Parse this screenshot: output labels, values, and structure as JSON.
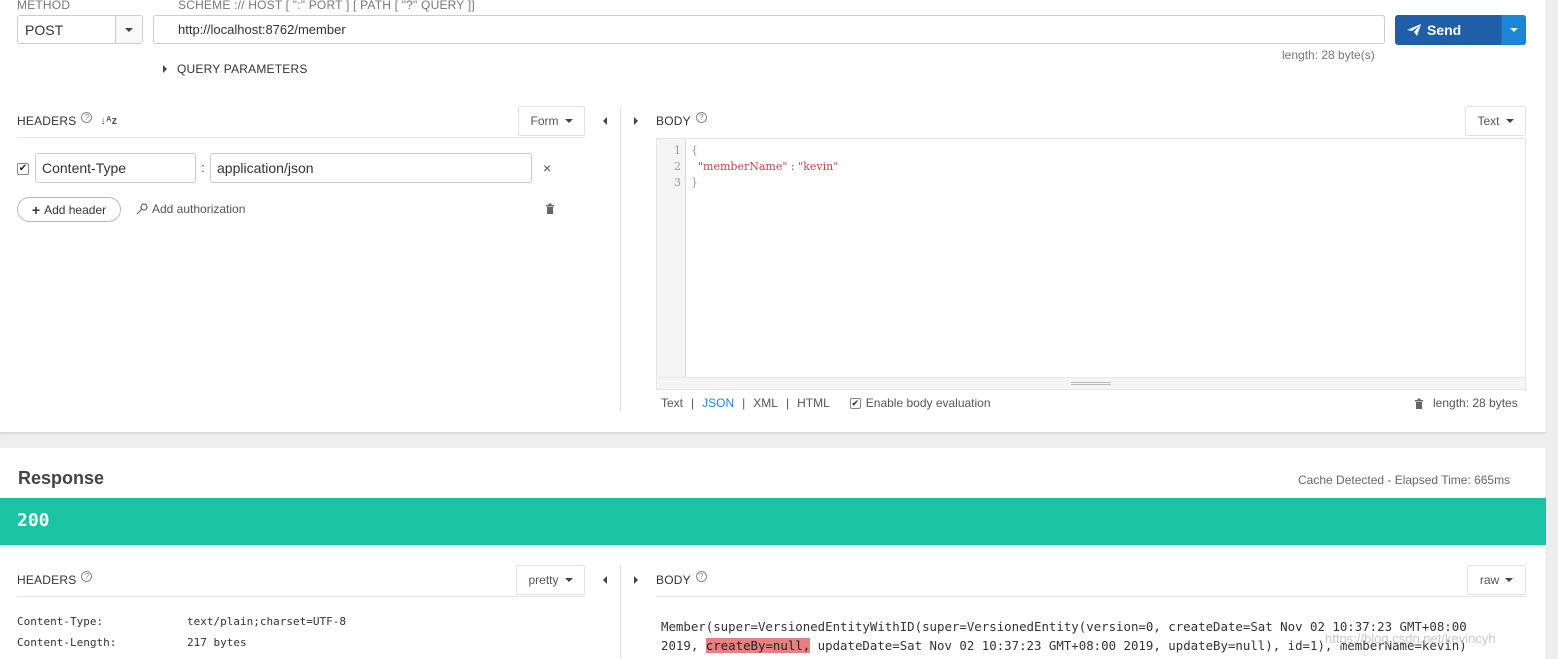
{
  "request": {
    "method_label": "METHOD",
    "method_value": "POST",
    "scheme_label": "SCHEME :// HOST [ \":\" PORT ] [ PATH [ \"?\" QUERY ]]",
    "url": "http://localhost:8762/member",
    "send_label": "Send",
    "length_note": "length: 28 byte(s)",
    "query_params_label": "QUERY PARAMETERS"
  },
  "req_headers": {
    "title": "HEADERS",
    "form_label": "Form",
    "items": [
      {
        "name": "Content-Type",
        "colon": ":",
        "value": "application/json",
        "remove": "×"
      }
    ],
    "add_header": "Add header",
    "add_authorization": "Add authorization"
  },
  "req_body": {
    "title": "BODY",
    "format_label": "Text",
    "line_numbers": [
      "1",
      "2",
      "3"
    ],
    "code": {
      "open": "{",
      "key": "\"memberName\"",
      "sep": " : ",
      "val": "\"kevin\"",
      "close": "}"
    },
    "footer": {
      "text": "Text",
      "json": "JSON",
      "xml": "XML",
      "html": "HTML",
      "separator": "|",
      "enable_eval": "Enable body evaluation",
      "length": "length: 28 bytes"
    }
  },
  "response": {
    "title": "Response",
    "elapsed": "Cache Detected - Elapsed Time: 665ms",
    "status": "200",
    "status_color": "#1bc3a5",
    "headers_title": "HEADERS",
    "headers_format": "pretty",
    "headers": [
      {
        "name": "Content-Type:",
        "value": "text/plain;charset=UTF-8"
      },
      {
        "name": "Content-Length:",
        "value": "217 bytes"
      }
    ],
    "body_title": "BODY",
    "body_format": "raw",
    "body_line1": "Member(super=VersionedEntityWithID(super=VersionedEntity(version=0, createDate=Sat Nov 02 10:37:23 GMT+08:00",
    "body_line2_pre": "2019, ",
    "body_line2_hl": "createBy=null,",
    "body_line2_post": " updateDate=Sat Nov 02 10:37:23 GMT+08:00 2019, updateBy=null), id=1), memberName=kevin)",
    "watermark": "https://blog.csdn.net/kevincyh"
  }
}
